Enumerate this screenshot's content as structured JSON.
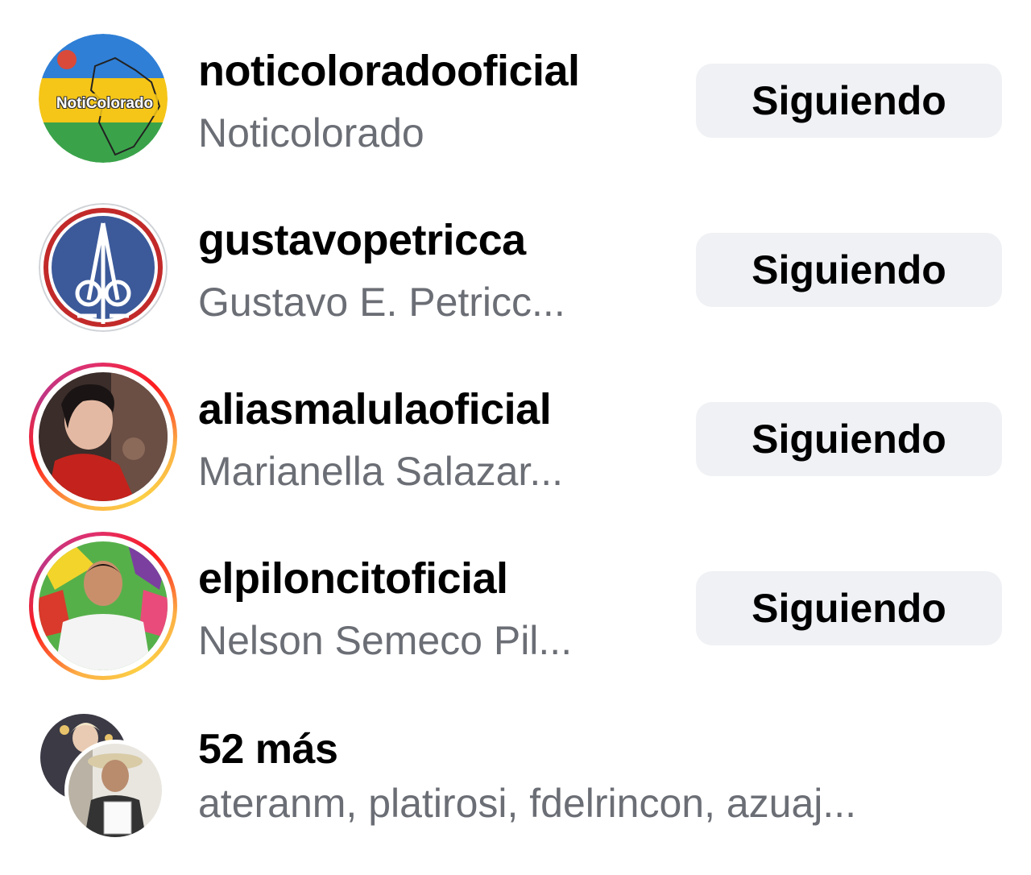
{
  "rows": [
    {
      "username": "noticoloradooficial",
      "fullname": "Noticolorado",
      "button": "Siguiendo",
      "avatar_text": "NotiColorado"
    },
    {
      "username": "gustavopetricca",
      "fullname": "Gustavo E. Petricc...",
      "button": "Siguiendo"
    },
    {
      "username": "aliasmalulaoficial",
      "fullname": "Marianella Salazar...",
      "button": "Siguiendo"
    },
    {
      "username": "elpiloncitoficial",
      "fullname": "Nelson Semeco Pil...",
      "button": "Siguiendo"
    }
  ],
  "more": {
    "label": "52 más",
    "names": "ateranm, platirosi, fdelrincon, azuaj..."
  },
  "colors": {
    "button_bg": "#eff1f4",
    "secondary_text": "#6b6e75",
    "story_ring": [
      "#fcb045",
      "#fd1d1d",
      "#c13584"
    ]
  }
}
